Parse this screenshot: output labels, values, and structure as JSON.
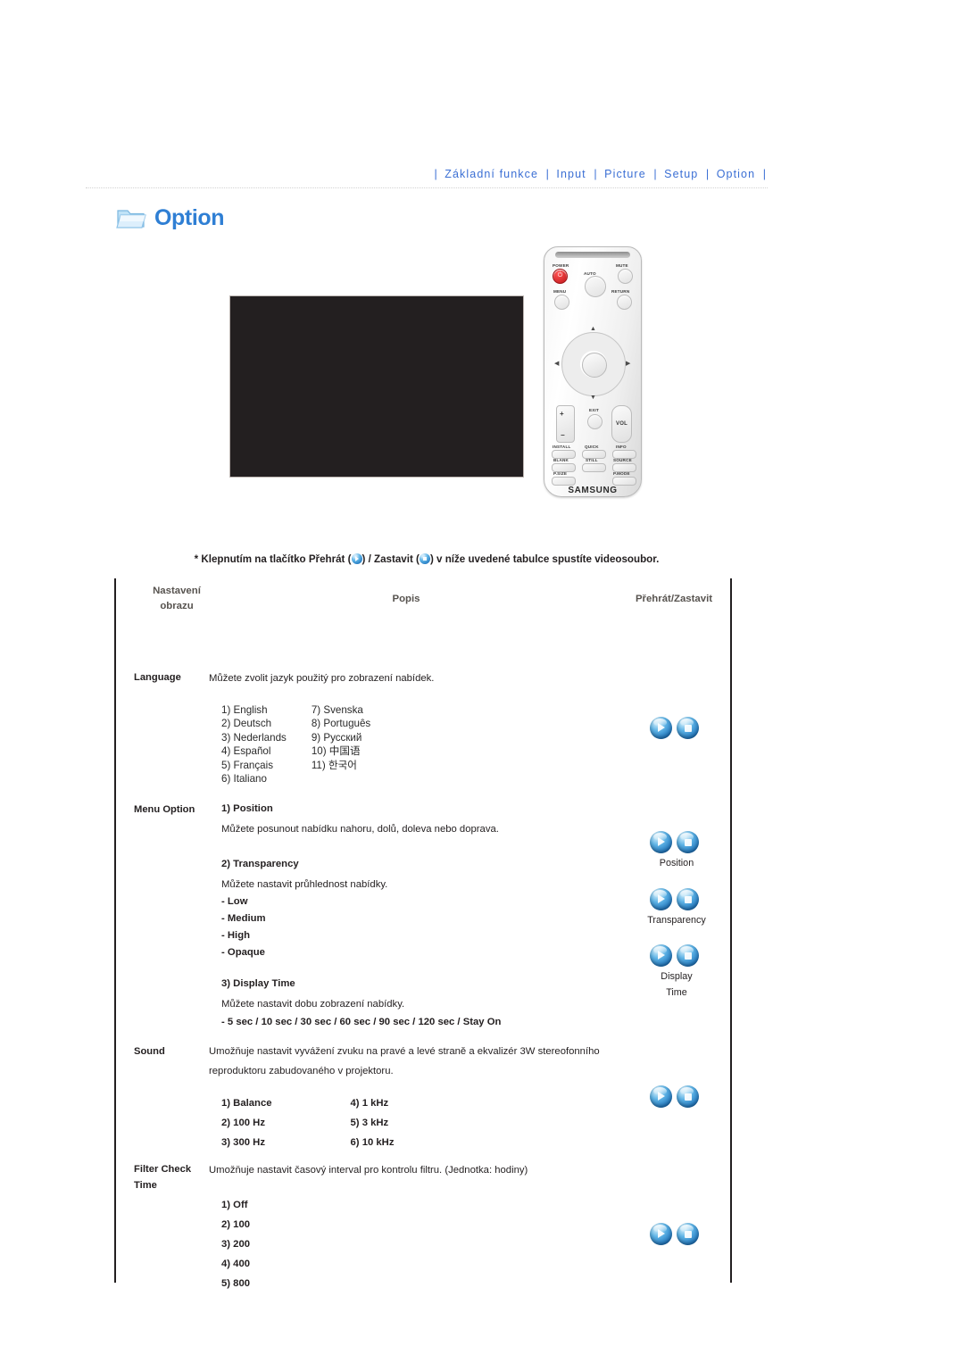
{
  "topnav": {
    "separator": "|",
    "items": [
      {
        "label": "Základní funkce"
      },
      {
        "label": "Input"
      },
      {
        "label": "Picture"
      },
      {
        "label": "Setup"
      },
      {
        "label": "Option"
      }
    ]
  },
  "section": {
    "title": "Option",
    "icon": "folder-icon"
  },
  "media": {
    "screenshot_alt": "projector-osd-screenshot",
    "remote": {
      "brand": "SAMSUNG",
      "labels": {
        "power": "POWER",
        "auto": "AUTO",
        "mute": "MUTE",
        "menu": "MENU",
        "return": "RETURN",
        "exit": "EXIT",
        "vol": "VOL",
        "install": "INSTALL",
        "quick": "QUICK",
        "info": "INFO",
        "blank": "BLANK",
        "still": "STILL",
        "source": "SOURCE",
        "psize": "P.SIZE",
        "pmode": "P.MODE"
      }
    }
  },
  "note": {
    "prefix": "* Klepnutím na tlačítko Přehrát (",
    "middle": ") / Zastavit (",
    "suffix": ") v níže uvedené tabulce spustíte videosoubor."
  },
  "table": {
    "headers": {
      "col1_line1": "Nastavení",
      "col1_line2": "obrazu",
      "col2": "Popis",
      "col3": "Přehrát/Zastavit"
    },
    "rows": [
      {
        "category": "Language",
        "description": "Můžete zvolit jazyk použitý pro zobrazení nabídek.",
        "languages_col1": [
          "1) English",
          "2) Deutsch",
          "3) Nederlands",
          "4) Español",
          "5) Français",
          "6) Italiano"
        ],
        "languages_col2": [
          "7) Svenska",
          "8) Português",
          "9) Русский",
          "10) 中国语",
          "11) 한국어"
        ],
        "button_label": ""
      },
      {
        "category": "Menu Option",
        "sub1_title": "1) Position",
        "sub1_desc": "Můžete posunout nabídku nahoru, dolů, doleva nebo doprava.",
        "sub1_button_label": "Position",
        "sub2_title": "2) Transparency",
        "sub2_desc": "Můžete nastavit průhlednost nabídky.",
        "sub2_options": [
          "- Low",
          "- Medium",
          "- High",
          "- Opaque"
        ],
        "sub2_button_label": "Transparency",
        "sub3_title": "3) Display Time",
        "sub3_desc": "Můžete nastavit dobu zobrazení nabídky.",
        "sub3_options": "- 5 sec / 10 sec / 30 sec / 60 sec / 90 sec / 120 sec / Stay On",
        "sub3_button_label_line1": "Display",
        "sub3_button_label_line2": "Time"
      },
      {
        "category": "Sound",
        "description_line1": "Umožňuje nastavit vyvážení zvuku na pravé a levé straně a ekvalizér 3W stereofonního",
        "description_line2": "reproduktoru zabudovaného v projektoru.",
        "options_col1": [
          "1) Balance",
          "2) 100 Hz",
          "3) 300 Hz"
        ],
        "options_col2": [
          "4) 1 kHz",
          "5) 3 kHz",
          "6) 10 kHz"
        ]
      },
      {
        "category_line1": "Filter Check",
        "category_line2": "Time",
        "description": "Umožňuje nastavit časový interval pro kontrolu filtru. (Jednotka: hodiny)",
        "options": [
          "1) Off",
          "2) 100",
          "3) 200",
          "4) 400",
          "5) 800"
        ]
      }
    ]
  },
  "colors": {
    "nav_link": "#3b6fd4",
    "section_title": "#2f7fd4",
    "header_text": "#57534f",
    "body_text": "#231f20",
    "orb_blue": "#2279c0"
  }
}
